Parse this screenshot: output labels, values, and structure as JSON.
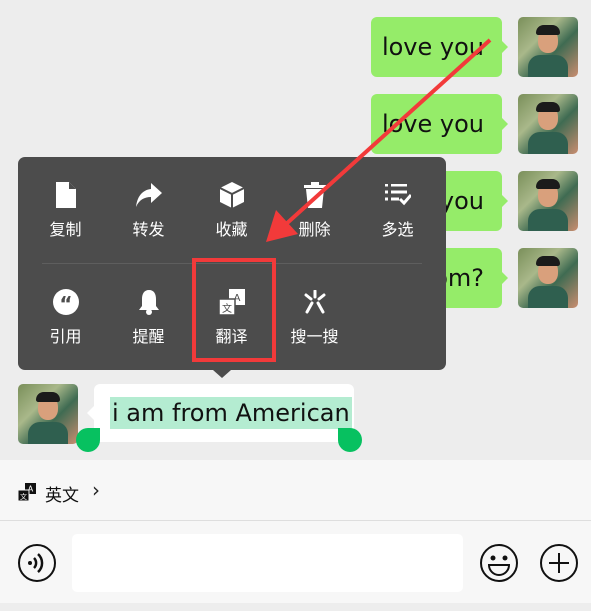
{
  "messages_out": [
    {
      "text": "love you"
    },
    {
      "text": "love you"
    },
    {
      "text": "love you"
    },
    {
      "text": "om?"
    }
  ],
  "message_in": {
    "text": "i am from American"
  },
  "context_menu": {
    "row1": [
      {
        "label": "复制",
        "icon": "file-icon"
      },
      {
        "label": "转发",
        "icon": "forward-icon"
      },
      {
        "label": "收藏",
        "icon": "cube-icon"
      },
      {
        "label": "删除",
        "icon": "trash-icon"
      },
      {
        "label": "多选",
        "icon": "multi-select-icon"
      }
    ],
    "row2": [
      {
        "label": "引用",
        "icon": "quote-icon"
      },
      {
        "label": "提醒",
        "icon": "bell-icon"
      },
      {
        "label": "翻译",
        "icon": "translate-icon"
      },
      {
        "label": "搜一搜",
        "icon": "search-sparkle-icon"
      }
    ]
  },
  "translate_bar": {
    "language": "英文",
    "chevron": "›"
  },
  "colors": {
    "bubble_out": "#95ec69",
    "menu_bg": "#4c4c4c",
    "selection": "#b4ecd1",
    "handle": "#07c160",
    "annotation": "#f23a3a"
  }
}
